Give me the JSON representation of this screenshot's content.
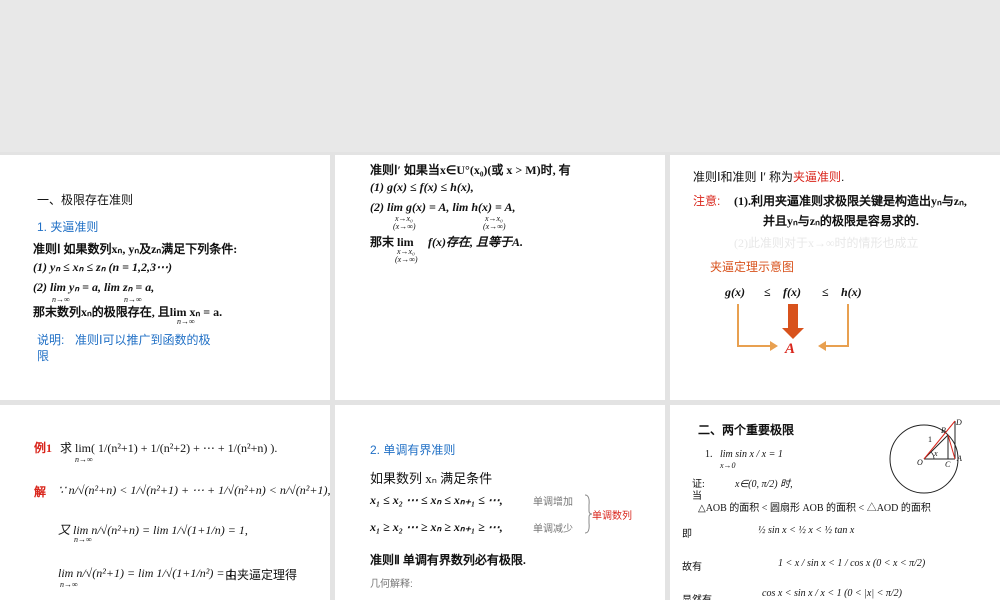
{
  "slide1": {
    "heading": "一、极限存在准则",
    "subheading": "1. 夹逼准则",
    "rule_line": "准则Ⅰ  如果数列xₙ, yₙ及zₙ满足下列条件:",
    "cond1": "(1) yₙ ≤ xₙ ≤ zₙ    (n = 1,2,3⋯)",
    "cond2": "(2) lim yₙ = a,   lim zₙ = a,",
    "lim_sub": "n→∞",
    "conclusion": "那末数列xₙ的极限存在, 且lim xₙ = a.",
    "note_label": "说明:",
    "note_text_1": "准则Ⅰ可以推广到函数的极",
    "note_text_2": "限"
  },
  "slide2": {
    "rule_line": "准则Ⅰ′  如果当x∈U°(x₀)(或 x > M)时, 有",
    "cond1": "(1)  g(x) ≤ f(x) ≤ h(x),",
    "cond2": "(2)  lim g(x) = A,   lim h(x) = A,",
    "lim_sub1": "x→x₀",
    "lim_sub2": "(x→∞)",
    "conclusion_a": "那末 lim",
    "conclusion_b": "f(x)存在,  且等于A."
  },
  "slide3": {
    "line1_a": "准则Ⅰ和准则 Ⅰ′ 称为",
    "line1_b": "夹逼准则",
    "line1_c": ".",
    "note_label": "注意:",
    "note1": "(1).利用夹逼准则求极限关键是构造出yₙ与zₙ,",
    "note2": "并且yₙ与zₙ的极限是容易求的.",
    "note3_faded": "(2)此准则对于x→∞时的情形也成立",
    "diagram_title": "夹逼定理示意图",
    "diagram_g": "g(x)",
    "diagram_le": "≤",
    "diagram_f": "f(x)",
    "diagram_h": "h(x)",
    "diagram_A": "A"
  },
  "slide4": {
    "example_label": "例1",
    "example_text": "求 lim( 1/(n²+1) + 1/(n²+2) + ⋯ + 1/(n²+n) ).",
    "solution_label": "解",
    "ineq": "∵ n/√(n²+n) < 1/√(n²+1) + ⋯ + 1/√(n²+n) < n/√(n²+1),",
    "lim1": "又 lim n/√(n²+n) = lim 1/√(1+1/n) = 1,",
    "lim2": "lim n/√(n²+1) = lim 1/√(1+1/n²) = 1,",
    "lim_sub": "n→∞",
    "by_squeeze": "由夹逼定理得"
  },
  "slide5": {
    "subheading": "2. 单调有界准则",
    "condition": "如果数列 xₙ 满足条件",
    "inc_seq": "x₁ ≤ x₂ ⋯ ≤ xₙ ≤ xₙ₊₁ ≤ ⋯,",
    "inc_label": "单调增加",
    "dec_seq": "x₁ ≥ x₂ ⋯ ≥ xₙ ≥ xₙ₊₁ ≥ ⋯,",
    "dec_label": "单调减少",
    "bracket_label": "单调数列",
    "rule": "准则Ⅱ  单调有界数列必有极限.",
    "geo": "几何解释:"
  },
  "slide6": {
    "heading": "二、两个重要极限",
    "item_num": "1.",
    "limit_expr": "lim sin x / x = 1",
    "lim_sub": "x→0",
    "proof_label": "证:",
    "proof_cond": "x∈(0, π/2)  时,",
    "proof_when": "当",
    "area_cmp": "△AOB 的面积 <  圆扇形 AOB 的面积  < △AOD 的面积",
    "ji_label": "即",
    "ji_expr": "½ sin x <  ½ x  < ½ tan x",
    "gu_label": "故有",
    "gu_expr": "1 < x / sin x < 1 / cos x    (0 < x < π/2)",
    "xian_label": "显然有",
    "xian_expr": "cos x < sin x / x < 1      (0 < |x| < π/2)",
    "fig_B": "B",
    "fig_D": "D",
    "fig_1": "1",
    "fig_x": "x",
    "fig_O": "O",
    "fig_C": "C",
    "fig_A": "A"
  },
  "colors": {
    "blue": "#1f6fc5",
    "red": "#d9251b",
    "orange": "#d8521c",
    "arrow_orange": "#e8a050"
  }
}
